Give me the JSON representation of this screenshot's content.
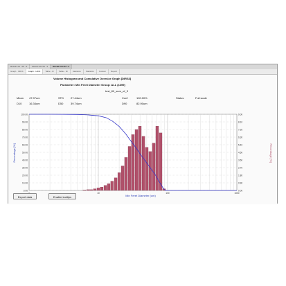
{
  "doc_tabs": [
    {
      "label": "Result List - 03 - 2"
    },
    {
      "label": "Result Info 03 - 2"
    },
    {
      "label": "Result Info 03 - 3",
      "active": true
    }
  ],
  "view_tabs": [
    {
      "label": "Graph - IMCS"
    },
    {
      "label": "Graph - HIC3",
      "active": true
    },
    {
      "label": "Table - IF"
    },
    {
      "label": "Table - ID"
    },
    {
      "label": "Statistics"
    },
    {
      "label": "Statistics"
    },
    {
      "label": "Custom"
    },
    {
      "label": "Report"
    }
  ],
  "header": {
    "title": "Volume Histogram and Cumulative Oversize Graph [DIRS3]",
    "subtitle": "Parameter: Min Feret Diameter  Group: ALL (1399)",
    "sample": "test_80_sum_of_3"
  },
  "stats": {
    "mean_label": "Mean",
    "mean_value": "47.97um",
    "std_label": "STD",
    "std_value": "27.44um",
    "conf_label": "Conf",
    "conf_value": "100.00%",
    "status_label": "Status",
    "status_value": "Full scale",
    "d10_label": "D10",
    "d10_value": "16.34um",
    "d50_label": "D50",
    "d50_value": "39.74um",
    "d90_label": "D90",
    "d90_value": "82.90um"
  },
  "buttons": {
    "export": "Export data",
    "tooltips": "Enable tooltips"
  },
  "chart_data": {
    "type": "bar",
    "xlabel": "Min Feret Diameter (um)",
    "ylabel": "Percentage [%]",
    "y2label": "Percentage [%]",
    "x_scale": "log",
    "x_ticks": [
      "1",
      "10",
      "100",
      "1000"
    ],
    "ylim": [
      0,
      100
    ],
    "y_ticks": [
      "0.00",
      "10.00",
      "20.00",
      "30.00",
      "40.00",
      "50.00",
      "60.00",
      "70.00",
      "80.00",
      "90.00",
      "100.00"
    ],
    "y2lim": [
      0,
      9
    ],
    "y2_ticks": [
      "0.00",
      "0.90",
      "1.80",
      "2.70",
      "3.60",
      "4.50",
      "5.40",
      "6.30",
      "7.20",
      "8.10",
      "9.00"
    ],
    "grid": true,
    "colors": {
      "bar": "#b0506a",
      "bar_edge": "#6e2a3c",
      "curve": "#3436c8"
    },
    "series": [
      {
        "kind": "histogram",
        "axis": "right",
        "x": [
          6.3,
          7.1,
          7.9,
          8.9,
          10,
          11.2,
          12.6,
          14.1,
          15.8,
          17.8,
          20,
          22.4,
          25.1,
          28.2,
          31.6,
          35.5,
          39.8,
          44.7,
          50.1,
          56.2,
          63.1,
          70.8,
          79.4,
          89.1
        ],
        "values": [
          0.05,
          0.1,
          0.1,
          0.2,
          0.3,
          0.4,
          0.6,
          0.8,
          1.1,
          1.5,
          2.1,
          2.9,
          3.9,
          5.2,
          6.6,
          7.2,
          7.6,
          6.4,
          5.1,
          4.6,
          5.6,
          7.6,
          6.8,
          0.2
        ]
      },
      {
        "kind": "cumulative_oversize",
        "axis": "left",
        "x": [
          1,
          2,
          3,
          5,
          7,
          10,
          13,
          16,
          20,
          25,
          30,
          35,
          40,
          45,
          50,
          55,
          60,
          65,
          70,
          75,
          80,
          85,
          90,
          95,
          100,
          1000
        ],
        "values": [
          100,
          100,
          99.9,
          99.7,
          99.2,
          98,
          95.5,
          91,
          84,
          74,
          64,
          56,
          48,
          42,
          36,
          31,
          26,
          22,
          17,
          12,
          8,
          4,
          1,
          0,
          0,
          0
        ]
      }
    ]
  }
}
